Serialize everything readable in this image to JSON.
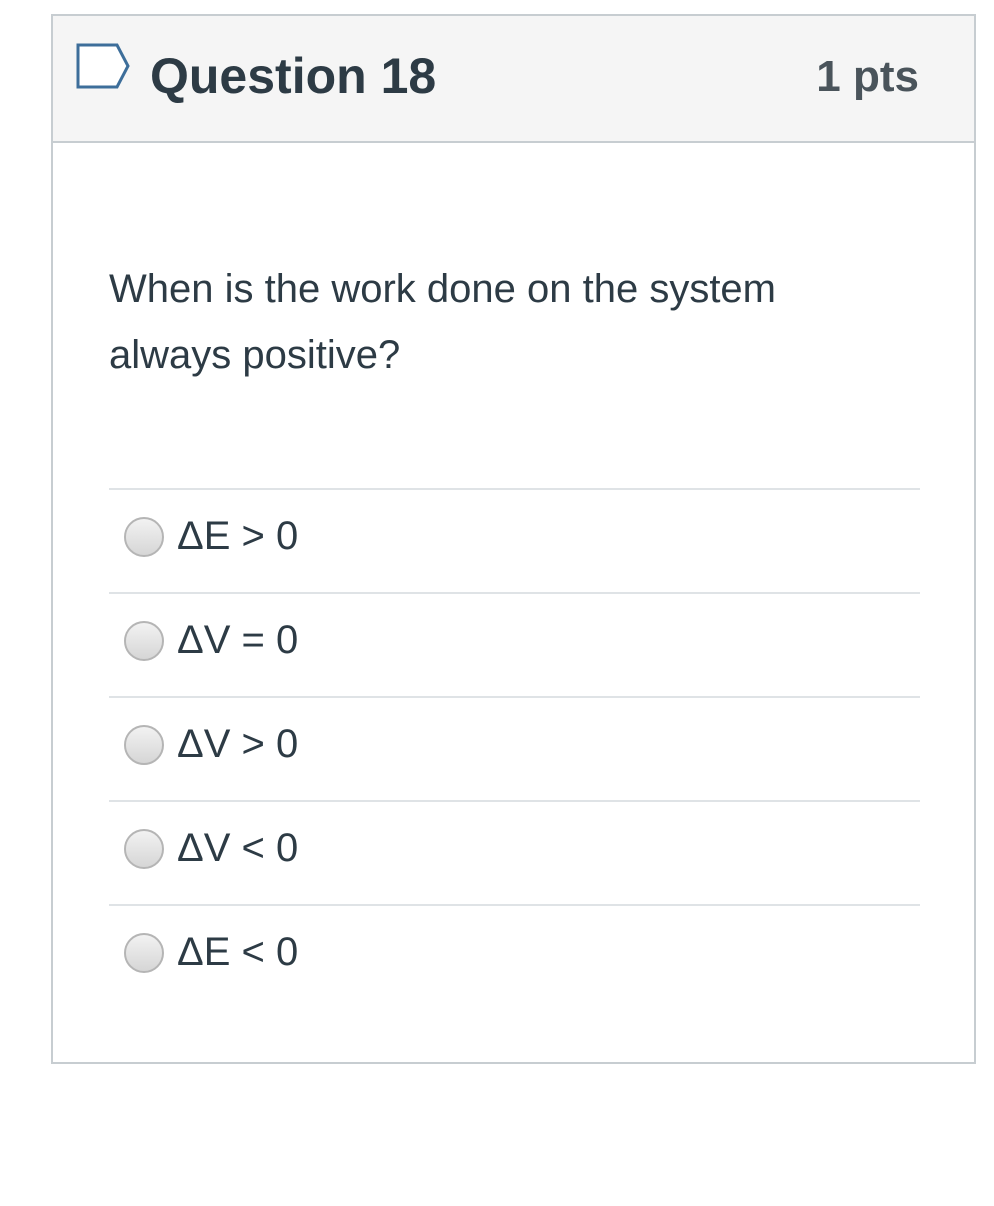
{
  "question": {
    "title": "Question 18",
    "points": "1 pts",
    "flag_icon": "flag-icon",
    "text": "When is the work done on the system always positive?"
  },
  "answers": [
    {
      "label": "ΔE > 0"
    },
    {
      "label": "ΔV = 0"
    },
    {
      "label": "ΔV > 0"
    },
    {
      "label": "ΔV < 0"
    },
    {
      "label": "ΔE < 0"
    }
  ],
  "colors": {
    "header_bg": "#f5f5f5",
    "border": "#c7cdd1",
    "text": "#2d3b45",
    "flag_stroke": "#3d6e9a"
  }
}
